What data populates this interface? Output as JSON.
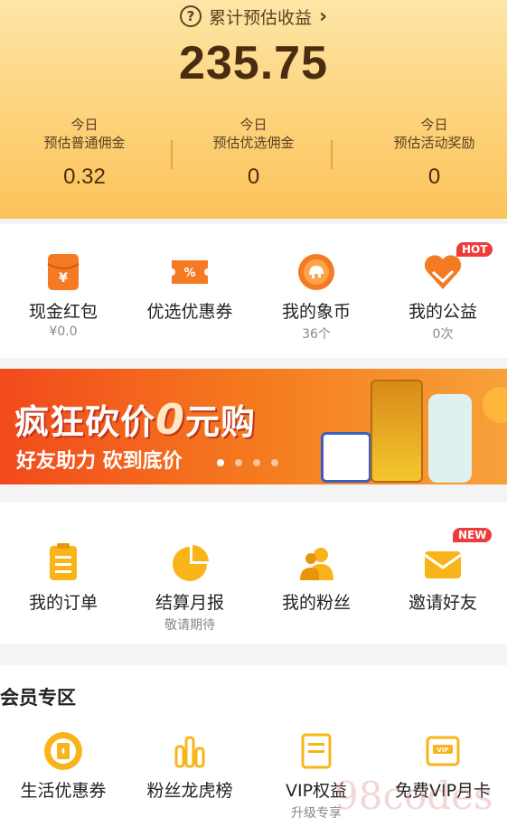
{
  "header": {
    "cumulative_label": "累计预估收益",
    "total": "235.75",
    "stats": [
      {
        "line1": "今日",
        "line2": "预估普通佣金",
        "value": "0.32"
      },
      {
        "line1": "今日",
        "line2": "预估优选佣金",
        "value": "0"
      },
      {
        "line1": "今日",
        "line2": "预估活动奖励",
        "value": "0"
      }
    ]
  },
  "quick": [
    {
      "label": "现金红包",
      "sub": "¥0.0",
      "icon": "red-envelope-icon"
    },
    {
      "label": "优选优惠券",
      "sub": "",
      "icon": "coupon-icon"
    },
    {
      "label": "我的象币",
      "sub": "36个",
      "icon": "elephant-coin-icon"
    },
    {
      "label": "我的公益",
      "sub": "0次",
      "icon": "charity-heart-icon",
      "badge": "HOT"
    }
  ],
  "banner": {
    "title_prefix": "疯狂砍价",
    "title_num": "0",
    "title_suffix": "元购",
    "subtitle": "好友助力 砍到底价"
  },
  "tools": [
    {
      "label": "我的订单",
      "sub": "",
      "icon": "order-list-icon"
    },
    {
      "label": "结算月报",
      "sub": "敬请期待",
      "icon": "pie-chart-icon"
    },
    {
      "label": "我的粉丝",
      "sub": "",
      "icon": "fans-icon"
    },
    {
      "label": "邀请好友",
      "sub": "",
      "icon": "invite-envelope-icon",
      "badge": "NEW"
    }
  ],
  "member": {
    "title": "会员专区",
    "items": [
      {
        "label": "生活优惠券",
        "sub": "",
        "icon": "life-coupon-icon"
      },
      {
        "label": "粉丝龙虎榜",
        "sub": "",
        "icon": "ranking-bars-icon"
      },
      {
        "label": "VIP权益",
        "sub": "升级专享",
        "icon": "vip-rights-icon"
      },
      {
        "label": "免费VIP月卡",
        "sub": "",
        "icon": "vip-card-icon"
      }
    ]
  },
  "watermark": "98codes",
  "colors": {
    "accent": "#f7a21a",
    "header_bg": "#fdd27a",
    "badge": "#ef3b3b"
  }
}
